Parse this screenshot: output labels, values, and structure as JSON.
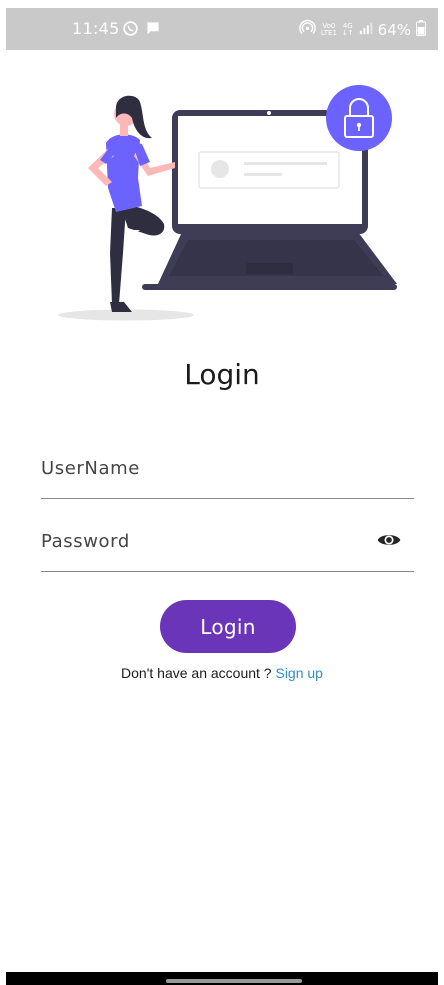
{
  "status_bar": {
    "time": "11:45",
    "network_top": "Vo0",
    "network_bottom": "LTE1",
    "signal_type_top": "4G",
    "signal_type_bottom": "↓↑",
    "battery": "64%",
    "icons": [
      "whatsapp-icon",
      "message-icon",
      "hotspot-icon",
      "signal-icon",
      "battery-icon"
    ]
  },
  "login": {
    "title": "Login",
    "username_placeholder": "UserName",
    "password_placeholder": "Password",
    "button_label": "Login",
    "no_account_text": "Don't have an account ? ",
    "signup_label": "Sign up"
  },
  "colors": {
    "primary": "#6b35b9",
    "illustration_accent": "#6c63ff",
    "link": "#2f8fc8",
    "laptop_dark": "#3f3d56"
  }
}
